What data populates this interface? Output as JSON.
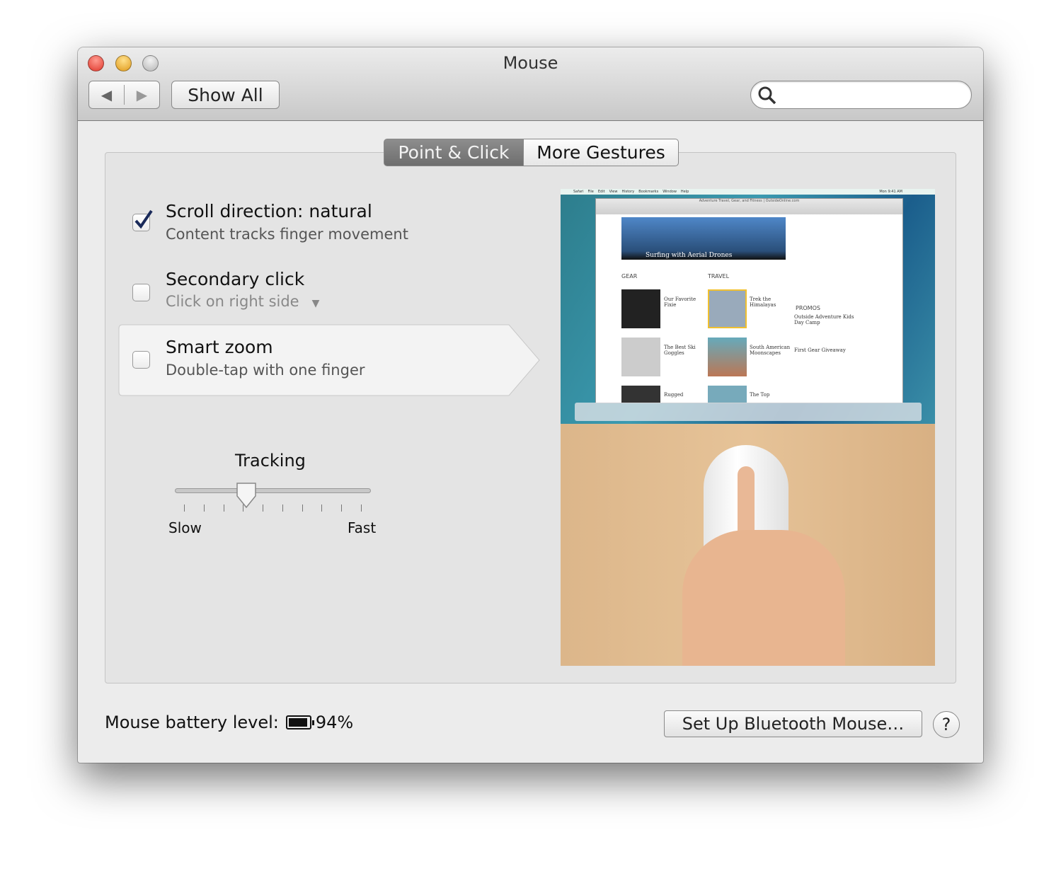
{
  "window": {
    "title": "Mouse"
  },
  "toolbar": {
    "show_all": "Show All",
    "search_placeholder": ""
  },
  "tabs": [
    {
      "label": "Point & Click",
      "selected": true
    },
    {
      "label": "More Gestures",
      "selected": false
    }
  ],
  "options": [
    {
      "title": "Scroll direction: natural",
      "subtitle": "Content tracks finger movement",
      "checked": true
    },
    {
      "title": "Secondary click",
      "subtitle": "Click on right side",
      "checked": false
    },
    {
      "title": "Smart zoom",
      "subtitle": "Double-tap with one finger",
      "checked": false
    }
  ],
  "tracking": {
    "label": "Tracking",
    "min_label": "Slow",
    "max_label": "Fast",
    "value_fraction": 0.35,
    "ticks": 10
  },
  "preview": {
    "headline": "Surfing with Aerial Drones",
    "sections": [
      "GEAR",
      "TRAVEL",
      "PROMOS"
    ],
    "menu": [
      "Safari",
      "File",
      "Edit",
      "View",
      "History",
      "Bookmarks",
      "Window",
      "Help"
    ],
    "clock": "Mon 9:41 AM",
    "url": "www.outsideonline.com",
    "page_title": "Adventure Travel, Gear, and Fitness | OutsideOnline.com",
    "articles": [
      "Our Favorite Fixie",
      "Trek the Himalayas",
      "The Best Ski Goggles",
      "South American Moonscapes",
      "Rugged",
      "The Top"
    ],
    "promos": [
      "Outside Adventure Kids Day Camp",
      "First Gear Giveaway"
    ]
  },
  "footer": {
    "battery_label": "Mouse battery level:",
    "battery_value": "94%",
    "setup_button": "Set Up Bluetooth Mouse…",
    "help": "?"
  }
}
